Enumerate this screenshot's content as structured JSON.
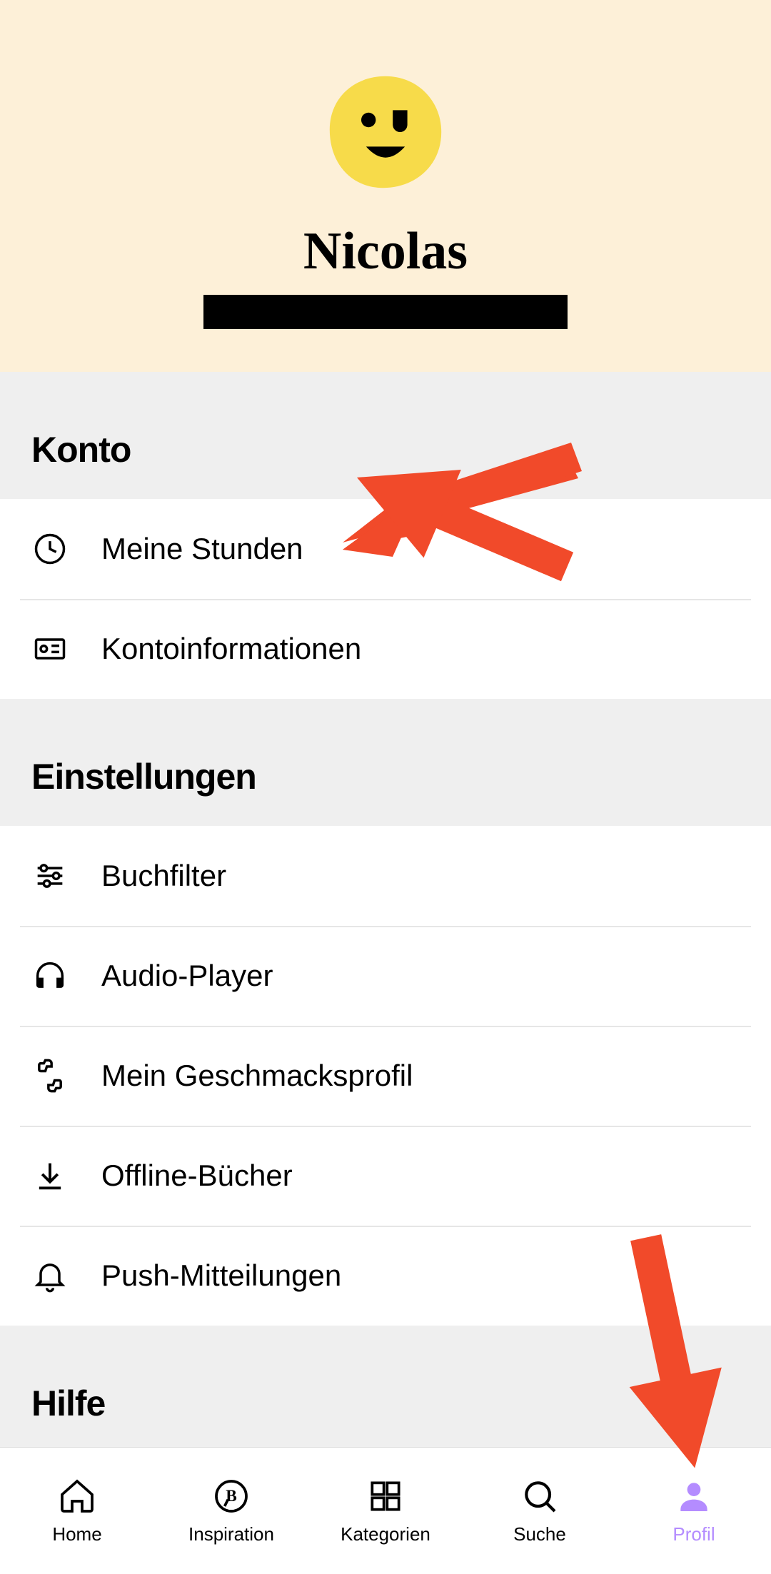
{
  "profile": {
    "name": "Nicolas"
  },
  "sections": {
    "konto": {
      "title": "Konto",
      "items": [
        {
          "label": "Meine Stunden",
          "icon": "clock-icon"
        },
        {
          "label": "Kontoinformationen",
          "icon": "id-card-icon"
        }
      ]
    },
    "einstellungen": {
      "title": "Einstellungen",
      "items": [
        {
          "label": "Buchfilter",
          "icon": "sliders-icon"
        },
        {
          "label": "Audio-Player",
          "icon": "headphones-icon"
        },
        {
          "label": "Mein Geschmacksprofil",
          "icon": "thumbs-icon"
        },
        {
          "label": "Offline-Bücher",
          "icon": "download-icon"
        },
        {
          "label": "Push-Mitteilungen",
          "icon": "bell-icon"
        }
      ]
    },
    "hilfe": {
      "title": "Hilfe"
    }
  },
  "tabs": [
    {
      "label": "Home",
      "icon": "home-icon",
      "active": false
    },
    {
      "label": "Inspiration",
      "icon": "inspiration-icon",
      "active": false
    },
    {
      "label": "Kategorien",
      "icon": "categories-icon",
      "active": false
    },
    {
      "label": "Suche",
      "icon": "search-icon",
      "active": false
    },
    {
      "label": "Profil",
      "icon": "profile-icon",
      "active": true
    }
  ],
  "annotations": {
    "arrow_color": "#f14a2a"
  }
}
